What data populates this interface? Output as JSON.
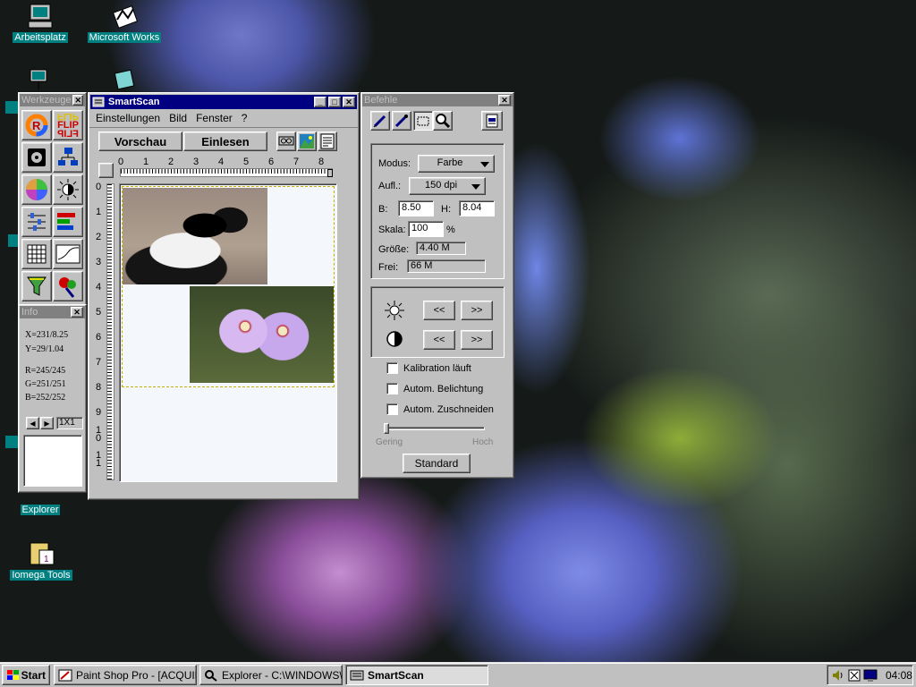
{
  "desktop": {
    "icons": [
      {
        "name": "my-computer-icon",
        "label": "Arbeitsplatz"
      },
      {
        "name": "microsoft-works-icon",
        "label": "Microsoft Works"
      },
      {
        "name": "explorer-icon",
        "label": "Explorer"
      },
      {
        "name": "iomega-tools-icon",
        "label": "Iomega Tools"
      }
    ]
  },
  "werkzeuge": {
    "title": "Werkzeuge",
    "tools": [
      "rotate-tool-icon",
      "flip-tool-icon",
      "scanner-tool-icon",
      "network-tool-icon",
      "color-wheel-tool-icon",
      "brightness-tool-icon",
      "levels-tool-icon",
      "histogram-tool-icon",
      "grid-tool-icon",
      "curve-tool-icon",
      "filter-tool-icon",
      "color-replace-tool-icon"
    ],
    "flip_text": "FLIP"
  },
  "info": {
    "title": "Info",
    "x": "X=231/8.25",
    "y": "Y=29/1.04",
    "r": "R=245/245",
    "g": "G=251/251",
    "b": "B=252/252",
    "zoom": "1X1"
  },
  "smartscan": {
    "title": "SmartScan",
    "menu": [
      "Einstellungen",
      "Bild",
      "Fenster",
      "?"
    ],
    "preview_button": "Vorschau",
    "scan_button": "Einlesen",
    "ruler_h": [
      "0",
      "1",
      "2",
      "3",
      "4",
      "5",
      "6",
      "7",
      "8"
    ],
    "ruler_v": [
      "0",
      "1",
      "2",
      "3",
      "4",
      "5",
      "6",
      "7",
      "8",
      "9",
      "1\n0",
      "1\n1"
    ]
  },
  "befehle": {
    "title": "Befehle",
    "modus_label": "Modus:",
    "modus_value": "Farbe",
    "aufl_label": "Aufl.:",
    "aufl_value": "150 dpi",
    "b_label": "B:",
    "b_value": "8.50",
    "h_label": "H:",
    "h_value": "8.04",
    "skala_label": "Skala:",
    "skala_value": "100",
    "skala_unit": "%",
    "groesse_label": "Größe:",
    "groesse_value": "4.40 M",
    "frei_label": "Frei:",
    "frei_value": "66 M",
    "less": "<<",
    "more": ">>",
    "calibration": "Kalibration läuft",
    "auto_exposure": "Autom. Belichtung",
    "auto_crop": "Autom. Zuschneiden",
    "slider_low": "Gering",
    "slider_high": "Hoch",
    "slider_value": 0,
    "standard_button": "Standard"
  },
  "taskbar": {
    "start": "Start",
    "tasks": [
      "Paint Shop Pro - [ACQUIRI...",
      "Explorer - C:\\WINDOWS\\...",
      "SmartScan"
    ],
    "clock": "04:08"
  },
  "colors": {
    "titlebar": "#000080",
    "desktop_label_bg": "#008080",
    "face": "#c0c0c0"
  }
}
